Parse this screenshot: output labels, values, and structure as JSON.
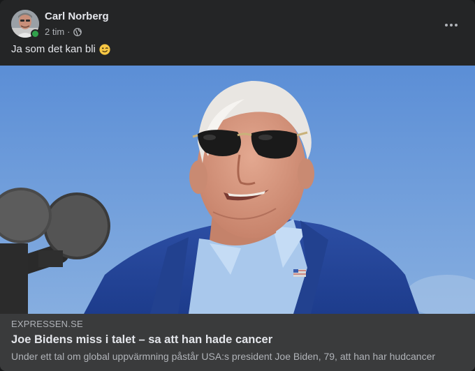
{
  "post": {
    "author_name": "Carl Norberg",
    "timestamp": "2 tim",
    "separator": "·",
    "privacy_icon": "globe-icon",
    "more_icon": "more-options-icon",
    "text": "Ja som det kan bli",
    "emoji": "winking-face-icon"
  },
  "photo": {
    "subject": "Joe Biden in sunglasses and blue suit at a microphone against a blue sky"
  },
  "link_preview": {
    "domain": "EXPRESSEN.SE",
    "title": "Joe Bidens miss i talet – sa att han hade cancer",
    "description": "Under ett tal om global uppvärmning påstår USA:s president Joe Biden, 79, att han har hudcancer"
  },
  "colors": {
    "card_bg": "#242526",
    "preview_bg": "#3a3b3c",
    "primary_text": "#e4e6eb",
    "secondary_text": "#b0b3b8",
    "online": "#31a24c"
  }
}
